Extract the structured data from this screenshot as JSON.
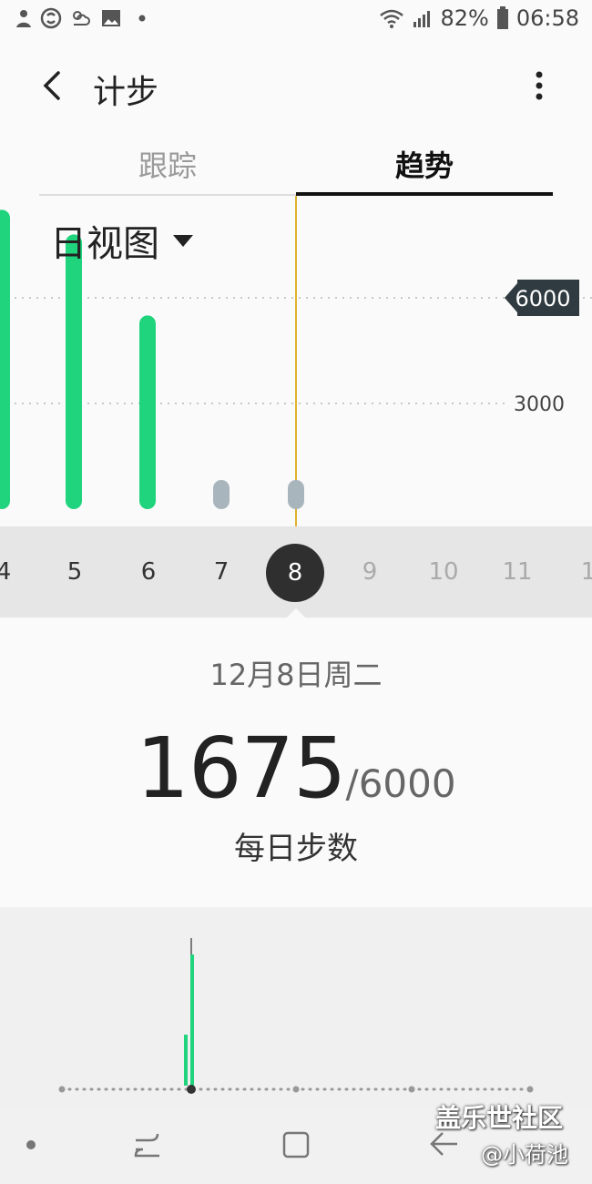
{
  "status_bar": {
    "battery": "82%",
    "time": "06:58"
  },
  "app_bar": {
    "title": "计步"
  },
  "tabs": [
    {
      "label": "跟踪",
      "active": false
    },
    {
      "label": "趋势",
      "active": true
    }
  ],
  "view_selector": {
    "label": "日视图"
  },
  "chart_data": {
    "type": "bar",
    "categories": [
      "4",
      "5",
      "6",
      "7",
      "8"
    ],
    "values": [
      8500,
      7800,
      5500,
      0,
      0
    ],
    "goal": 6000,
    "gridlines": [
      6000,
      3000
    ],
    "goal_label": "6000",
    "grid_label": "3000"
  },
  "date_strip": {
    "days": [
      "4",
      "5",
      "6",
      "7",
      "8",
      "9",
      "10",
      "11",
      "1"
    ],
    "selected": "8"
  },
  "detail": {
    "date": "12月8日周二",
    "steps": "1675",
    "goal": "/6000",
    "label": "每日步数"
  },
  "watermark": {
    "line1": "盖乐世社区",
    "line2": "@小荷池"
  },
  "colors": {
    "bar_active": "#20d47e",
    "bar_inactive": "#a9b5bc",
    "accent_line": "#e0b030"
  }
}
